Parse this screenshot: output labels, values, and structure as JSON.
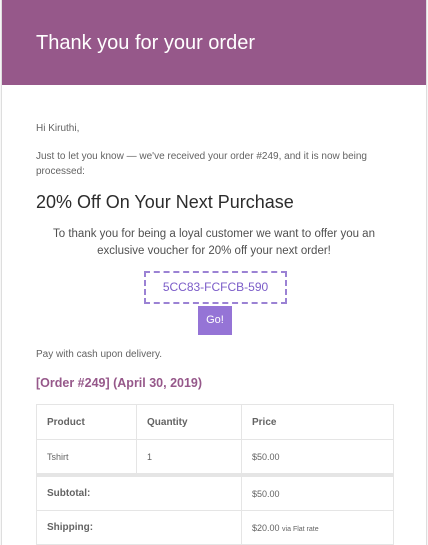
{
  "header": {
    "title": "Thank you for your order"
  },
  "body": {
    "greeting": "Hi Kiruthi,",
    "intro": "Just to let you know — we've received your order #249, and it is now being processed:"
  },
  "promo": {
    "title": "20% Off On Your Next Purchase",
    "text": "To thank you for being a loyal customer we want to offer you an exclusive voucher for 20% off your next order!",
    "coupon_code": "5CC83-FCFCB-590",
    "button_label": "Go!",
    "coupon_color": "#7b5cc8",
    "button_color": "#9574d6"
  },
  "payment": {
    "note": "Pay with cash upon delivery."
  },
  "order": {
    "heading": "[Order #249] (April 30, 2019)",
    "columns": [
      "Product",
      "Quantity",
      "Price"
    ],
    "items": [
      {
        "product": "Tshirt",
        "quantity": "1",
        "price": "$50.00"
      }
    ],
    "totals": [
      {
        "label": "Subtotal:",
        "value": "$50.00"
      },
      {
        "label": "Shipping:",
        "value": "$20.00",
        "via": "via Flat rate"
      }
    ]
  },
  "colors": {
    "brand": "#96588a",
    "text": "#636363"
  }
}
